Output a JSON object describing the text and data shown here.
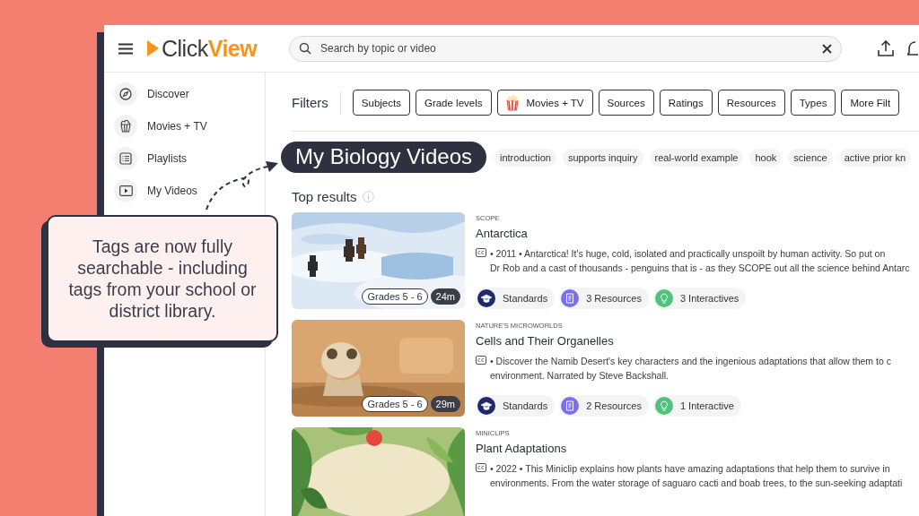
{
  "logo": {
    "text": "Click**View**"
  },
  "search": {
    "placeholder": "Search by topic or video"
  },
  "sidebar": {
    "items": [
      {
        "label": "Discover",
        "kind": "compass"
      },
      {
        "label": "Movies + TV",
        "kind": "popcorn"
      },
      {
        "label": "Playlists",
        "kind": "list"
      },
      {
        "label": "My Videos",
        "kind": "play"
      }
    ]
  },
  "filters": {
    "label": "Filters",
    "buttons": [
      {
        "label": "Subjects",
        "kind": "plain"
      },
      {
        "label": "Grade levels",
        "kind": "plain"
      },
      {
        "label": "Movies + TV",
        "kind": "popcorn"
      },
      {
        "label": "Sources",
        "kind": "plain"
      },
      {
        "label": "Ratings",
        "kind": "plain"
      },
      {
        "label": "Resources",
        "kind": "plain"
      },
      {
        "label": "Types",
        "kind": "plain"
      },
      {
        "label": "More Filt",
        "kind": "plain"
      }
    ]
  },
  "query_tag": "My Biology Videos",
  "tags": [
    "introduction",
    "supports inquiry",
    "real-world example",
    "hook",
    "science",
    "active prior kn"
  ],
  "results": {
    "title": "Top results",
    "items": [
      {
        "kind": "snow",
        "publisher": "SCOPE",
        "title": "Antarctica",
        "description": "• 2011 • Antarctica! It's huge, cold, isolated and practically unspoilt by human activity. So put on\nDr Rob and a cast of thousands - penguins that is - as they SCOPE out all the science behind Antarc",
        "grades": "Grades 5 - 6",
        "duration": "24m",
        "chips": [
          {
            "kind": "standards",
            "label": "Standards"
          },
          {
            "kind": "resources",
            "label": "3 Resources"
          },
          {
            "kind": "interactives",
            "label": "3 Interactives"
          }
        ]
      },
      {
        "kind": "desert",
        "publisher": "NATURE'S MICROWORLDS",
        "title": "Cells and Their Organelles",
        "description": "• Discover the Namib Desert's key characters and the ingenious adaptations that allow them to c\nenvironment. Narrated by Steve Backshall.",
        "grades": "Grades 5 - 6",
        "duration": "29m",
        "chips": [
          {
            "kind": "standards",
            "label": "Standards"
          },
          {
            "kind": "resources",
            "label": "2 Resources"
          },
          {
            "kind": "interactives",
            "label": "1 Interactive"
          }
        ]
      },
      {
        "kind": "plant",
        "publisher": "MINICLIPS",
        "title": "Plant Adaptations",
        "description": "• 2022 • This Miniclip explains how plants have amazing adaptations that help them to survive in\nenvironments. From the water storage of saguaro cacti and boab trees, to the sun-seeking adaptati"
      }
    ]
  },
  "callout": {
    "text": "Tags are now fully searchable - including tags from your school or district library."
  }
}
